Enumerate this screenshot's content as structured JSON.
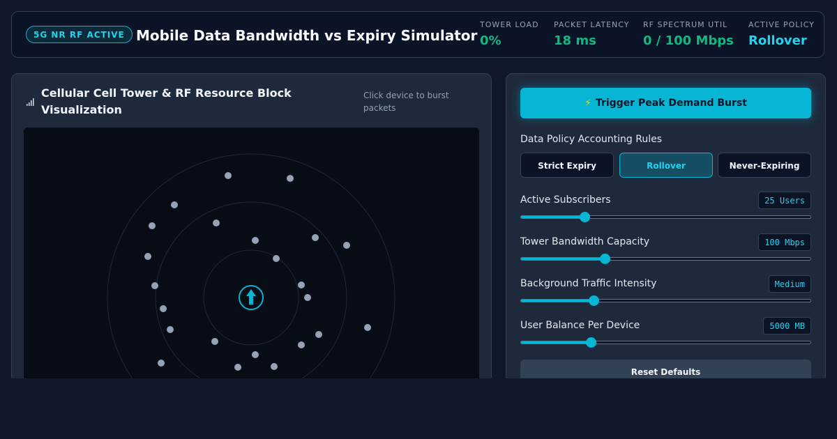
{
  "header": {
    "badge": "5G NR RF ACTIVE",
    "title": "Mobile Data Bandwidth vs Expiry Simulator",
    "stats": [
      {
        "label": "TOWER LOAD",
        "value": "0%",
        "color": "#10b981"
      },
      {
        "label": "PACKET LATENCY",
        "value": "18 ms",
        "color": "#10b981"
      },
      {
        "label": "RF SPECTRUM UTIL",
        "value": "0 / 100 Mbps",
        "color": "#10b981"
      },
      {
        "label": "ACTIVE POLICY",
        "value": "Rollover",
        "color": "#22d3ee"
      }
    ]
  },
  "visualization": {
    "title": "Cellular Cell Tower & RF Resource Block Visualization",
    "hint": "Click device to burst packets",
    "icons": [
      "signal-icon",
      "tower-icon"
    ]
  },
  "controls": {
    "burst_label": "Trigger Peak Demand Burst",
    "burst_icon": "⚡",
    "policy_section_label": "Data Policy Accounting Rules",
    "policies": [
      {
        "label": "Strict Expiry",
        "active": false
      },
      {
        "label": "Rollover",
        "active": true
      },
      {
        "label": "Never-Expiring",
        "active": false
      }
    ],
    "sliders": [
      {
        "label": "Active Subscribers",
        "value_text": "25 Users",
        "fraction": 0.22
      },
      {
        "label": "Tower Bandwidth Capacity",
        "value_text": "100 Mbps",
        "fraction": 0.29
      },
      {
        "label": "Background Traffic Intensity",
        "value_text": "Medium",
        "fraction": 0.25
      },
      {
        "label": "User Balance Per Device",
        "value_text": "5000 MB",
        "fraction": 0.24
      }
    ],
    "reset_label": "Reset Defaults"
  },
  "colors": {
    "accent": "#06b6d4",
    "accent_text": "#22d3ee",
    "good": "#10b981",
    "device": "#94a3b8"
  }
}
